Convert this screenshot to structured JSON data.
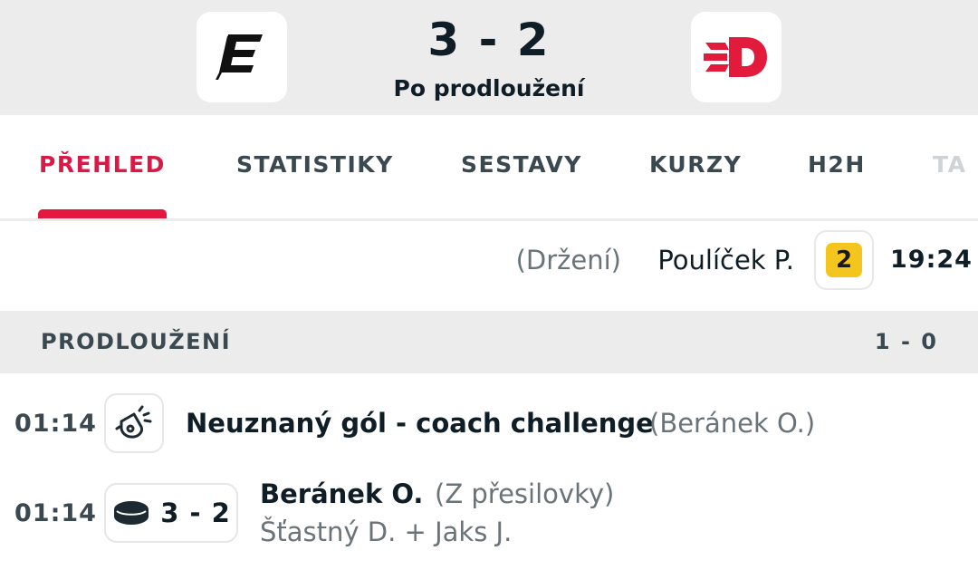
{
  "match": {
    "score": "3 - 2",
    "status": "Po prodloužení"
  },
  "tabs": [
    {
      "label": "PŘEHLED"
    },
    {
      "label": "STATISTIKY"
    },
    {
      "label": "SESTAVY"
    },
    {
      "label": "KURZY"
    },
    {
      "label": "H2H"
    },
    {
      "label": "TA"
    }
  ],
  "penalty_event": {
    "reason": "(Držení)",
    "player": "Poulíček P.",
    "minutes": "2",
    "time": "19:24"
  },
  "period": {
    "name": "PRODLOUŽENÍ",
    "score": "1 - 0"
  },
  "events": [
    {
      "time": "01:14",
      "icon": "whistle-icon",
      "title": "Neuznaný gól - coach challenge",
      "player": "(Beránek O.)"
    },
    {
      "time": "01:14",
      "icon": "puck-icon",
      "score": "3 - 2",
      "scorer": "Beránek O.",
      "note": "(Z přesilovky)",
      "assists": "Šťastný D.  +  Jaks J."
    }
  ],
  "colors": {
    "accent": "#e4173f",
    "header_bg": "#ececec",
    "penalty_badge": "#f4c51c",
    "away_logo_red": "#e21b3c"
  }
}
